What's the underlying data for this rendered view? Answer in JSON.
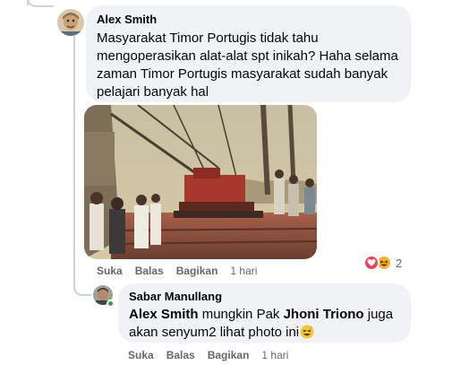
{
  "comment1": {
    "author": "Alex Smith",
    "text_lines": [
      "Masyarakat Timor Portugis tidak tahu",
      "mengoperasikan alat-alat spt inikah? Haha selama",
      "zaman Timor Portugis masyarakat sudah banyak",
      "pelajari banyak hal"
    ],
    "actions": {
      "like": "Suka",
      "reply": "Balas",
      "share": "Bagikan",
      "time": "1 hari"
    },
    "reaction_count": "2",
    "reaction_icons": [
      "heart-icon",
      "laugh-icon"
    ]
  },
  "comment2": {
    "author": "Sabar Manullang",
    "mention1": "Alex Smith",
    "text_mid": " mungkin Pak ",
    "mention2": "Jhoni Triono",
    "text_end1": " juga",
    "text_line2": "akan senyum2 lihat photo ini",
    "emoji": "grinning-sweat-emoji",
    "actions": {
      "like": "Suka",
      "reply": "Balas",
      "share": "Bagikan",
      "time": "1 hari"
    }
  },
  "colors": {
    "bubble": "#f0f2f5",
    "thread": "#ced0d4",
    "meta": "#65676b",
    "heart": "#f33e58",
    "haha": "#f7b125",
    "online": "#31a24c"
  }
}
